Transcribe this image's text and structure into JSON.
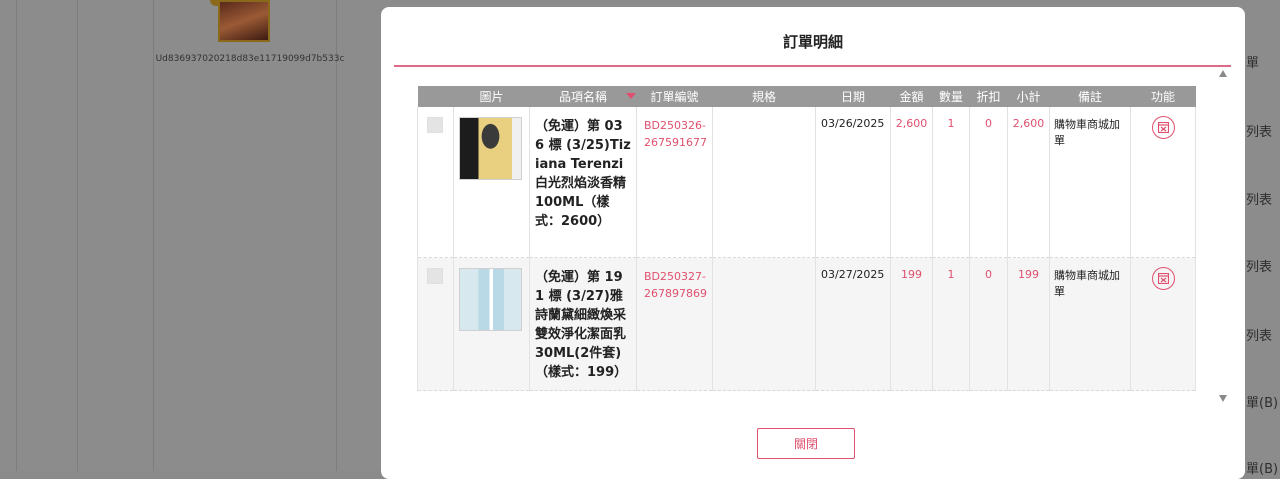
{
  "background": {
    "uid": "Ud836937020218d83e11719099d7b533c",
    "right_labels": [
      "單",
      "列表",
      "列表",
      "列表",
      "列表",
      "單(B)",
      "單(B)"
    ]
  },
  "modal": {
    "title": "訂單明細",
    "columns": [
      "圖片",
      "品項名稱",
      "訂單編號",
      "規格",
      "日期",
      "金額",
      "數量",
      "折扣",
      "小計",
      "備註",
      "功能"
    ],
    "rows": [
      {
        "thumbnail": "perfume-bottle",
        "name": "（免運）第 036 標 (3/25)Tiziana Terenzi 白光烈焰淡香精100ML（樣式：2600）",
        "order_no": "BD250326-267591677",
        "spec": "",
        "date": "03/26/2025",
        "amount": "2,600",
        "qty": "1",
        "discount": "0",
        "subtotal": "2,600",
        "remark": "購物車商城加單",
        "action_icon": "cancel-order-icon"
      },
      {
        "thumbnail": "cleanser-tube",
        "name": "（免運）第 191 標 (3/27)雅詩蘭黛細緻煥采雙效淨化潔面乳 30ML(2件套)（樣式：199）",
        "order_no": "BD250327-267897869",
        "spec": "",
        "date": "03/27/2025",
        "amount": "199",
        "qty": "1",
        "discount": "0",
        "subtotal": "199",
        "remark": "購物車商城加單",
        "action_icon": "cancel-order-icon"
      }
    ],
    "close_label": "關閉"
  },
  "colors": {
    "accent": "#e0506e",
    "header_bg": "#999999"
  }
}
